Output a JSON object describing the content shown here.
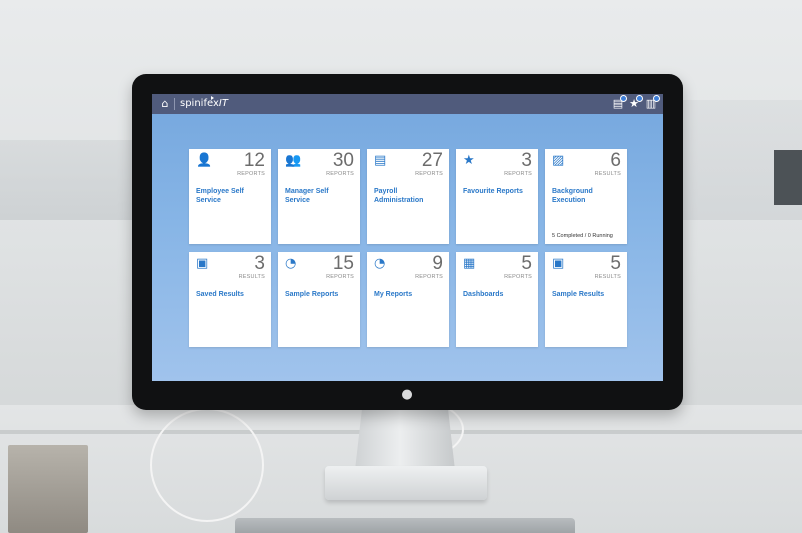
{
  "header": {
    "brand_prefix": "spinifex",
    "brand_suffix": "IT",
    "icons": [
      "home-icon",
      "saved-results-icon",
      "favourite-star-icon",
      "report-chart-icon"
    ]
  },
  "tiles": [
    {
      "icon": "employee-icon",
      "glyph": "👤",
      "count": "12",
      "unit": "REPORTS",
      "label": "Employee Self Service",
      "status": ""
    },
    {
      "icon": "manager-group-icon",
      "glyph": "👥",
      "count": "30",
      "unit": "REPORTS",
      "label": "Manager Self Service",
      "status": ""
    },
    {
      "icon": "payroll-icon",
      "glyph": "▤",
      "count": "27",
      "unit": "REPORTS",
      "label": "Payroll Administration",
      "status": ""
    },
    {
      "icon": "star-icon",
      "glyph": "★",
      "count": "3",
      "unit": "REPORTS",
      "label": "Favourite Reports",
      "status": ""
    },
    {
      "icon": "image-icon",
      "glyph": "▨",
      "count": "6",
      "unit": "RESULTS",
      "label": "Background Execution",
      "status": "5 Completed / 0 Running"
    },
    {
      "icon": "save-icon",
      "glyph": "▣",
      "count": "3",
      "unit": "RESULTS",
      "label": "Saved Results",
      "status": ""
    },
    {
      "icon": "feed-icon",
      "glyph": "◔",
      "count": "15",
      "unit": "REPORTS",
      "label": "Sample Reports",
      "status": ""
    },
    {
      "icon": "feed-icon",
      "glyph": "◔",
      "count": "9",
      "unit": "REPORTS",
      "label": "My Reports",
      "status": ""
    },
    {
      "icon": "dashboard-icon",
      "glyph": "▦",
      "count": "5",
      "unit": "REPORTS",
      "label": "Dashboards",
      "status": ""
    },
    {
      "icon": "sample-results-icon",
      "glyph": "▣",
      "count": "5",
      "unit": "RESULTS",
      "label": "Sample Results",
      "status": ""
    }
  ]
}
